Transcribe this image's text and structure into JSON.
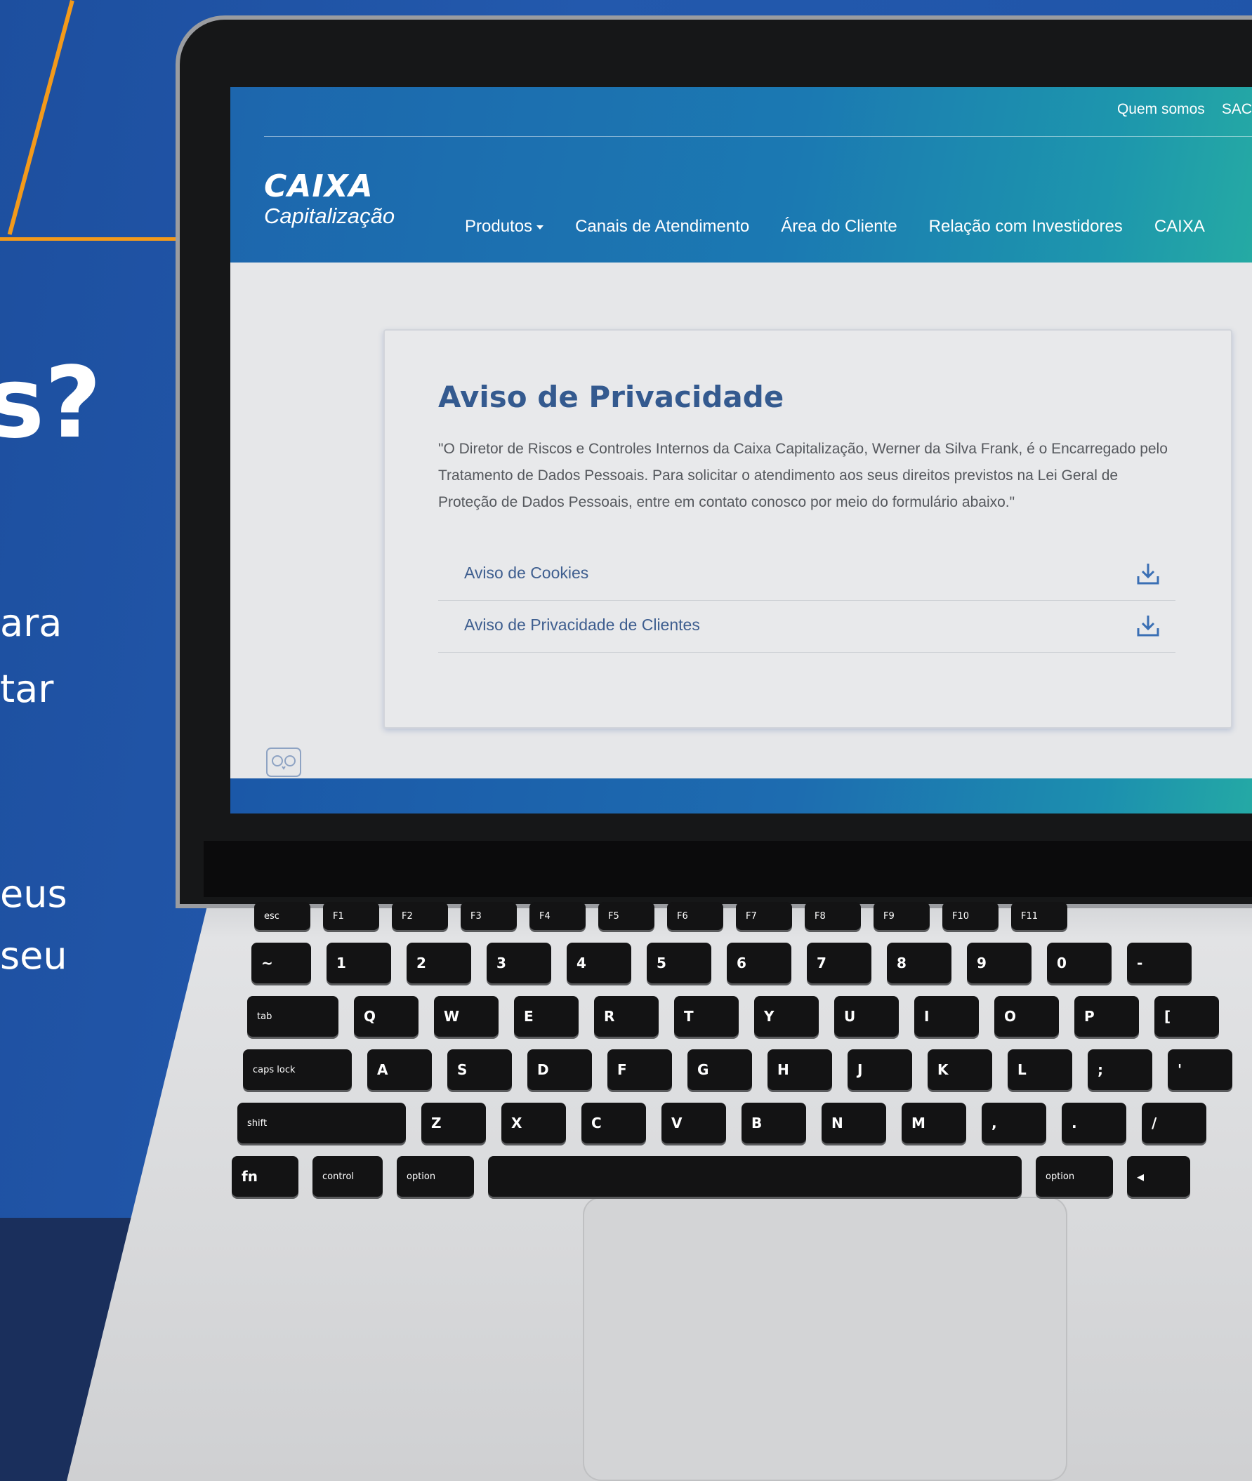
{
  "promo": {
    "question_mark": "s?",
    "lines": [
      "ara",
      "tar",
      "eus",
      "seu"
    ]
  },
  "site": {
    "top_nav": [
      "Quem somos",
      "SAC"
    ],
    "logo": {
      "top": "CAIXA",
      "bottom": "Capitalização"
    },
    "main_nav": [
      {
        "label": "Produtos",
        "dropdown": true
      },
      {
        "label": "Canais de Atendimento"
      },
      {
        "label": "Área do Cliente"
      },
      {
        "label": "Relação com Investidores"
      },
      {
        "label": "CAIXA"
      }
    ],
    "notice": {
      "title": "Aviso de Privacidade",
      "body": "\"O Diretor de Riscos e Controles Internos da Caixa Capitalização, Werner da Silva Frank, é o Encarregado pelo Tratamento de Dados Pessoais. Para solicitar o atendimento aos seus direitos previstos na Lei Geral de Proteção de Dados Pessoais, entre em contato conosco por meio do formulário abaixo.\"",
      "documents": [
        {
          "label": "Aviso de Cookies",
          "icon": "download-icon"
        },
        {
          "label": "Aviso de Privacidade de Clientes",
          "icon": "download-icon"
        }
      ]
    },
    "accessibility_icon": "owl-icon"
  },
  "keyboard": {
    "row_fn": [
      "esc",
      "F1",
      "F2",
      "F3",
      "F4",
      "F5",
      "F6",
      "F7",
      "F8",
      "F9",
      "F10",
      "F11"
    ],
    "row_num": [
      "~",
      "1",
      "2",
      "3",
      "4",
      "5",
      "6",
      "7",
      "8",
      "9",
      "0",
      "-",
      "="
    ],
    "row_q": [
      "tab",
      "Q",
      "W",
      "E",
      "R",
      "T",
      "Y",
      "U",
      "I",
      "O",
      "P",
      "[",
      "]"
    ],
    "row_a": [
      "caps lock",
      "A",
      "S",
      "D",
      "F",
      "G",
      "H",
      "J",
      "K",
      "L",
      ";",
      "'"
    ],
    "row_z": [
      "shift",
      "Z",
      "X",
      "C",
      "V",
      "B",
      "N",
      "M",
      ",",
      ".",
      "/"
    ],
    "row_bottom": [
      "fn",
      "control",
      "option",
      "",
      "option",
      "◂"
    ]
  },
  "colors": {
    "brand_blue": "#1d66ad",
    "brand_teal": "#25aaa4",
    "accent_orange": "#f39a1b",
    "title_blue": "#345a8f"
  }
}
